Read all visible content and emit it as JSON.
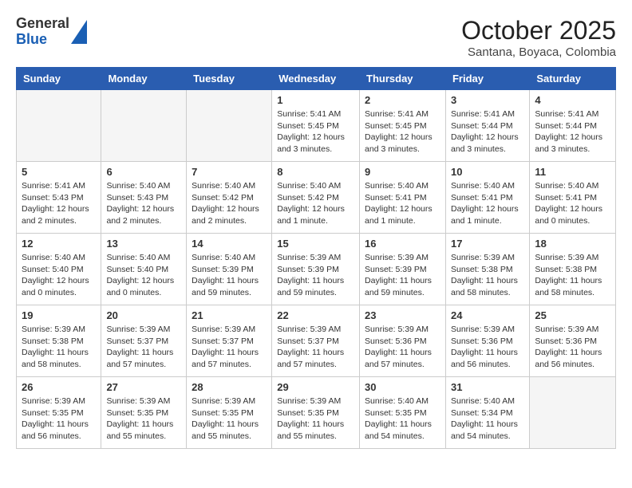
{
  "header": {
    "logo_general": "General",
    "logo_blue": "Blue",
    "month": "October 2025",
    "location": "Santana, Boyaca, Colombia"
  },
  "days_of_week": [
    "Sunday",
    "Monday",
    "Tuesday",
    "Wednesday",
    "Thursday",
    "Friday",
    "Saturday"
  ],
  "weeks": [
    [
      {
        "day": "",
        "text": ""
      },
      {
        "day": "",
        "text": ""
      },
      {
        "day": "",
        "text": ""
      },
      {
        "day": "1",
        "text": "Sunrise: 5:41 AM\nSunset: 5:45 PM\nDaylight: 12 hours\nand 3 minutes."
      },
      {
        "day": "2",
        "text": "Sunrise: 5:41 AM\nSunset: 5:45 PM\nDaylight: 12 hours\nand 3 minutes."
      },
      {
        "day": "3",
        "text": "Sunrise: 5:41 AM\nSunset: 5:44 PM\nDaylight: 12 hours\nand 3 minutes."
      },
      {
        "day": "4",
        "text": "Sunrise: 5:41 AM\nSunset: 5:44 PM\nDaylight: 12 hours\nand 3 minutes."
      }
    ],
    [
      {
        "day": "5",
        "text": "Sunrise: 5:41 AM\nSunset: 5:43 PM\nDaylight: 12 hours\nand 2 minutes."
      },
      {
        "day": "6",
        "text": "Sunrise: 5:40 AM\nSunset: 5:43 PM\nDaylight: 12 hours\nand 2 minutes."
      },
      {
        "day": "7",
        "text": "Sunrise: 5:40 AM\nSunset: 5:42 PM\nDaylight: 12 hours\nand 2 minutes."
      },
      {
        "day": "8",
        "text": "Sunrise: 5:40 AM\nSunset: 5:42 PM\nDaylight: 12 hours\nand 1 minute."
      },
      {
        "day": "9",
        "text": "Sunrise: 5:40 AM\nSunset: 5:41 PM\nDaylight: 12 hours\nand 1 minute."
      },
      {
        "day": "10",
        "text": "Sunrise: 5:40 AM\nSunset: 5:41 PM\nDaylight: 12 hours\nand 1 minute."
      },
      {
        "day": "11",
        "text": "Sunrise: 5:40 AM\nSunset: 5:41 PM\nDaylight: 12 hours\nand 0 minutes."
      }
    ],
    [
      {
        "day": "12",
        "text": "Sunrise: 5:40 AM\nSunset: 5:40 PM\nDaylight: 12 hours\nand 0 minutes."
      },
      {
        "day": "13",
        "text": "Sunrise: 5:40 AM\nSunset: 5:40 PM\nDaylight: 12 hours\nand 0 minutes."
      },
      {
        "day": "14",
        "text": "Sunrise: 5:40 AM\nSunset: 5:39 PM\nDaylight: 11 hours\nand 59 minutes."
      },
      {
        "day": "15",
        "text": "Sunrise: 5:39 AM\nSunset: 5:39 PM\nDaylight: 11 hours\nand 59 minutes."
      },
      {
        "day": "16",
        "text": "Sunrise: 5:39 AM\nSunset: 5:39 PM\nDaylight: 11 hours\nand 59 minutes."
      },
      {
        "day": "17",
        "text": "Sunrise: 5:39 AM\nSunset: 5:38 PM\nDaylight: 11 hours\nand 58 minutes."
      },
      {
        "day": "18",
        "text": "Sunrise: 5:39 AM\nSunset: 5:38 PM\nDaylight: 11 hours\nand 58 minutes."
      }
    ],
    [
      {
        "day": "19",
        "text": "Sunrise: 5:39 AM\nSunset: 5:38 PM\nDaylight: 11 hours\nand 58 minutes."
      },
      {
        "day": "20",
        "text": "Sunrise: 5:39 AM\nSunset: 5:37 PM\nDaylight: 11 hours\nand 57 minutes."
      },
      {
        "day": "21",
        "text": "Sunrise: 5:39 AM\nSunset: 5:37 PM\nDaylight: 11 hours\nand 57 minutes."
      },
      {
        "day": "22",
        "text": "Sunrise: 5:39 AM\nSunset: 5:37 PM\nDaylight: 11 hours\nand 57 minutes."
      },
      {
        "day": "23",
        "text": "Sunrise: 5:39 AM\nSunset: 5:36 PM\nDaylight: 11 hours\nand 57 minutes."
      },
      {
        "day": "24",
        "text": "Sunrise: 5:39 AM\nSunset: 5:36 PM\nDaylight: 11 hours\nand 56 minutes."
      },
      {
        "day": "25",
        "text": "Sunrise: 5:39 AM\nSunset: 5:36 PM\nDaylight: 11 hours\nand 56 minutes."
      }
    ],
    [
      {
        "day": "26",
        "text": "Sunrise: 5:39 AM\nSunset: 5:35 PM\nDaylight: 11 hours\nand 56 minutes."
      },
      {
        "day": "27",
        "text": "Sunrise: 5:39 AM\nSunset: 5:35 PM\nDaylight: 11 hours\nand 55 minutes."
      },
      {
        "day": "28",
        "text": "Sunrise: 5:39 AM\nSunset: 5:35 PM\nDaylight: 11 hours\nand 55 minutes."
      },
      {
        "day": "29",
        "text": "Sunrise: 5:39 AM\nSunset: 5:35 PM\nDaylight: 11 hours\nand 55 minutes."
      },
      {
        "day": "30",
        "text": "Sunrise: 5:40 AM\nSunset: 5:35 PM\nDaylight: 11 hours\nand 54 minutes."
      },
      {
        "day": "31",
        "text": "Sunrise: 5:40 AM\nSunset: 5:34 PM\nDaylight: 11 hours\nand 54 minutes."
      },
      {
        "day": "",
        "text": ""
      }
    ]
  ]
}
